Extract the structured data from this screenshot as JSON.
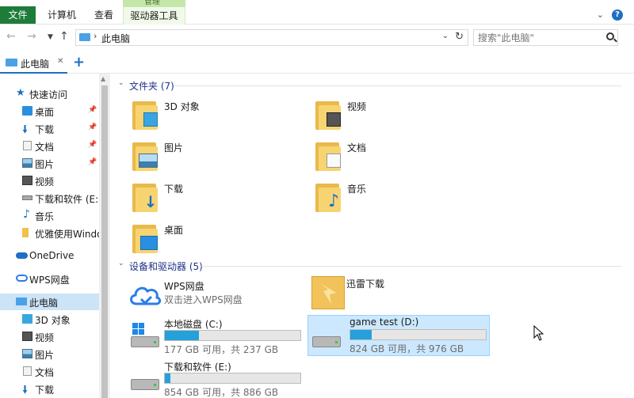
{
  "ribbon": {
    "context_header": "管理",
    "tabs": [
      "文件",
      "计算机",
      "查看",
      "驱动器工具"
    ]
  },
  "address": {
    "path": "此电脑",
    "search_placeholder": "搜索\"此电脑\""
  },
  "doc_tab": {
    "label": "此电脑"
  },
  "sidebar": {
    "quick_access": "快速访问",
    "quick_items": [
      {
        "label": "桌面",
        "icon": "desktop-icon",
        "pinned": true
      },
      {
        "label": "下载",
        "icon": "download-icon",
        "pinned": true
      },
      {
        "label": "文档",
        "icon": "document-icon",
        "pinned": true
      },
      {
        "label": "图片",
        "icon": "pictures-icon",
        "pinned": true
      },
      {
        "label": "视频",
        "icon": "video-icon",
        "pinned": false
      },
      {
        "label": "下载和软件 (E:)",
        "icon": "drive-icon",
        "pinned": false
      },
      {
        "label": "音乐",
        "icon": "music-icon",
        "pinned": false
      },
      {
        "label": "优雅使用Windows",
        "icon": "folder-icon",
        "pinned": false
      }
    ],
    "onedrive": "OneDrive",
    "wps": "WPS网盘",
    "this_pc": "此电脑",
    "pc_items": [
      {
        "label": "3D 对象",
        "icon": "3d-objects-icon"
      },
      {
        "label": "视频",
        "icon": "video-icon"
      },
      {
        "label": "图片",
        "icon": "pictures-icon"
      },
      {
        "label": "文档",
        "icon": "document-icon"
      },
      {
        "label": "下载",
        "icon": "download-icon"
      }
    ]
  },
  "folders_section": {
    "title": "文件夹 (7)",
    "items": [
      {
        "label": "3D 对象",
        "icon": "3d-objects-icon"
      },
      {
        "label": "视频",
        "icon": "video-icon"
      },
      {
        "label": "图片",
        "icon": "pictures-icon"
      },
      {
        "label": "文档",
        "icon": "document-icon"
      },
      {
        "label": "下载",
        "icon": "download-icon"
      },
      {
        "label": "音乐",
        "icon": "music-icon"
      },
      {
        "label": "桌面",
        "icon": "desktop-icon"
      }
    ]
  },
  "devices_section": {
    "title": "设备和驱动器 (5)",
    "wps": {
      "label": "WPS网盘",
      "sub": "双击进入WPS网盘"
    },
    "xunlei": {
      "label": "迅雷下载"
    },
    "drives": [
      {
        "label": "本地磁盘 (C:)",
        "sub": "177 GB 可用，共 237 GB",
        "used_fraction": 0.25,
        "selected": false
      },
      {
        "label": "game test (D:)",
        "sub": "824 GB 可用，共 976 GB",
        "used_fraction": 0.16,
        "selected": true
      },
      {
        "label": "下载和软件 (E:)",
        "sub": "854 GB 可用，共 886 GB",
        "used_fraction": 0.04,
        "selected": false
      }
    ]
  },
  "colors": {
    "accent": "#1e6fc2",
    "file_tab": "#1e7c3a",
    "context_tab": "#c4e7a8",
    "drive_bar": "#26a0da",
    "selection": "#cce8ff"
  }
}
